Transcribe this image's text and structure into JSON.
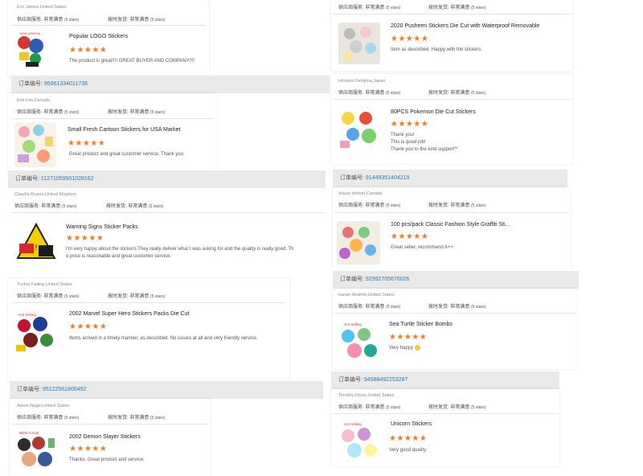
{
  "labels": {
    "supplier_service": "供应商服务: 非常满意",
    "on_time_shipping": "按时发货: 非常满意",
    "five_stars": "(5 stars)",
    "order_no": "订单编号:"
  },
  "left": [
    {
      "reviewer": "Eric James,United States",
      "title": "Popular LOGO Stickers",
      "stars": 5,
      "review": "The product is great!!!! GREAT BUYER AND COMPANY!!!!",
      "badge": "NEW ARRIVAL"
    },
    {
      "order_number": "95861334011738",
      "reviewer": "Eric Lee,Canada",
      "title": "Small Fresh Cartoon Stickers for USA Market",
      "stars": 5,
      "review": "Great product and great customer service. Thank you"
    },
    {
      "order_number": "11271059501028162",
      "reviewer": "Claudia Ruano,United Kingdom",
      "title": "Warning Signs Sticker Packs",
      "stars": 5,
      "review": "I'm very happy about the stickers.They really deliver what I was asking for and the quality is really good. Th\ne price is reasonable and great customer service."
    },
    {
      "reviewer": "Tucker Failing,United States",
      "title": "2002 Marvel Super Hero Stickers Packs Die Cut",
      "stars": 5,
      "review": "Items arrived in a timely manner, as described. No issues at all and very friendly service.",
      "badge": "Hot Selling"
    },
    {
      "order_number": "95122561805492",
      "reviewer": "Aaron Nagel,United States",
      "title": "2002 Demon Slayer Stickers",
      "stars": 5,
      "review": "Thanks. Great product and service.",
      "badge": "NEW Arrival"
    }
  ],
  "right": [
    {
      "title": "2020 Pusheen Stickers Die Cut with Waterproof Removable",
      "stars": 5,
      "review": "Item as described. Happy with the stickers."
    },
    {
      "reviewer": "Hiroomi Oshijima,Japan",
      "title": "80PCS Pokemon Die Cut Stickers",
      "stars": 5,
      "review": "Thank you!\nThis is good job!\nThank you to the kind support**"
    },
    {
      "order_number": "91449351404219",
      "reviewer": "shaun demerj,Canada",
      "title": "100 pcs/pack Classic Fashion Style Graffiti Sti...",
      "stars": 5,
      "review": "Great seller, recommend A++"
    },
    {
      "order_number": "92992705676026",
      "reviewer": "hanan Ibrahim,United States",
      "title": "Sea Turtle Sticker Bombs",
      "stars": 5,
      "review": "Very happy",
      "badge": "Hot Selling"
    },
    {
      "order_number": "94588492253287",
      "reviewer": "Timothy Dixon,United States",
      "title": "Unicorn Stickers",
      "stars": 5,
      "review": "Very good quality.",
      "badge": "Hot Selling"
    }
  ],
  "colors": {
    "star": "#f47a1f",
    "order_link": "#2a7ab8",
    "header_bg": "#e9e9e9"
  }
}
